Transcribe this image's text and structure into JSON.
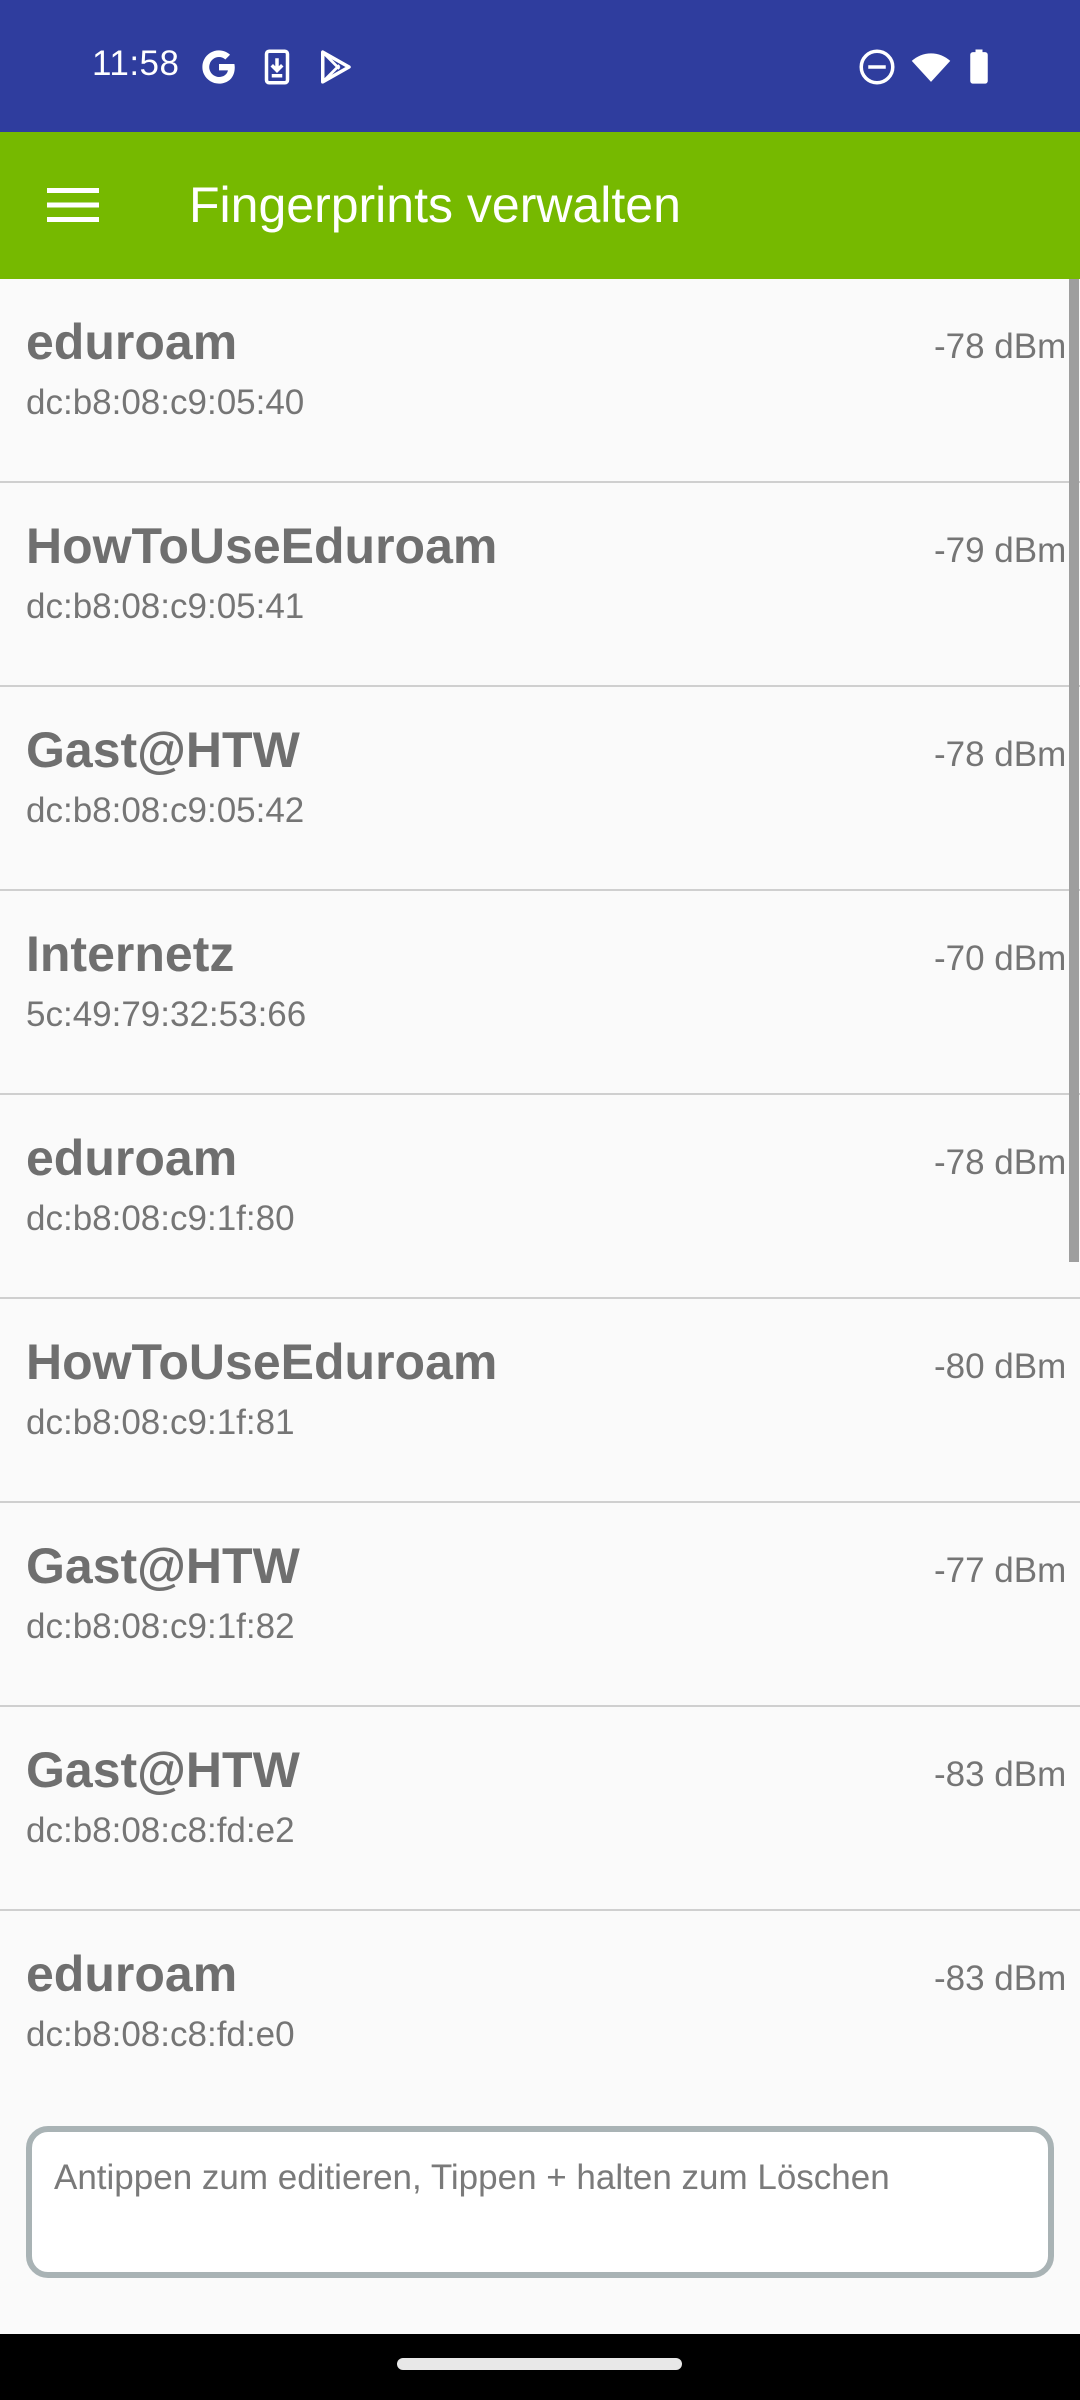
{
  "status_bar": {
    "time": "11:58",
    "left_icons": [
      "google-icon",
      "download-icon",
      "play-store-icon"
    ],
    "right_icons": [
      "do-not-disturb-icon",
      "wifi-icon",
      "battery-icon"
    ],
    "background": "#2f3d9e"
  },
  "app_bar": {
    "title": "Fingerprints verwalten",
    "menu_icon": "hamburger-menu-icon",
    "background": "#76b900"
  },
  "fingerprints": [
    {
      "ssid": "eduroam",
      "bssid": "dc:b8:08:c9:05:40",
      "signal": "-78 dBm"
    },
    {
      "ssid": "HowToUseEduroam",
      "bssid": "dc:b8:08:c9:05:41",
      "signal": "-79 dBm"
    },
    {
      "ssid": "Gast@HTW",
      "bssid": "dc:b8:08:c9:05:42",
      "signal": "-78 dBm"
    },
    {
      "ssid": "Internetz",
      "bssid": "5c:49:79:32:53:66",
      "signal": "-70 dBm"
    },
    {
      "ssid": "eduroam",
      "bssid": "dc:b8:08:c9:1f:80",
      "signal": "-78 dBm"
    },
    {
      "ssid": "HowToUseEduroam",
      "bssid": "dc:b8:08:c9:1f:81",
      "signal": "-80 dBm"
    },
    {
      "ssid": "Gast@HTW",
      "bssid": "dc:b8:08:c9:1f:82",
      "signal": "-77 dBm"
    },
    {
      "ssid": "Gast@HTW",
      "bssid": "dc:b8:08:c8:fd:e2",
      "signal": "-83 dBm"
    },
    {
      "ssid": "eduroam",
      "bssid": "dc:b8:08:c8:fd:e0",
      "signal": "-83 dBm"
    }
  ],
  "hint": {
    "text": "Antippen zum editieren, Tippen + halten zum Löschen"
  }
}
